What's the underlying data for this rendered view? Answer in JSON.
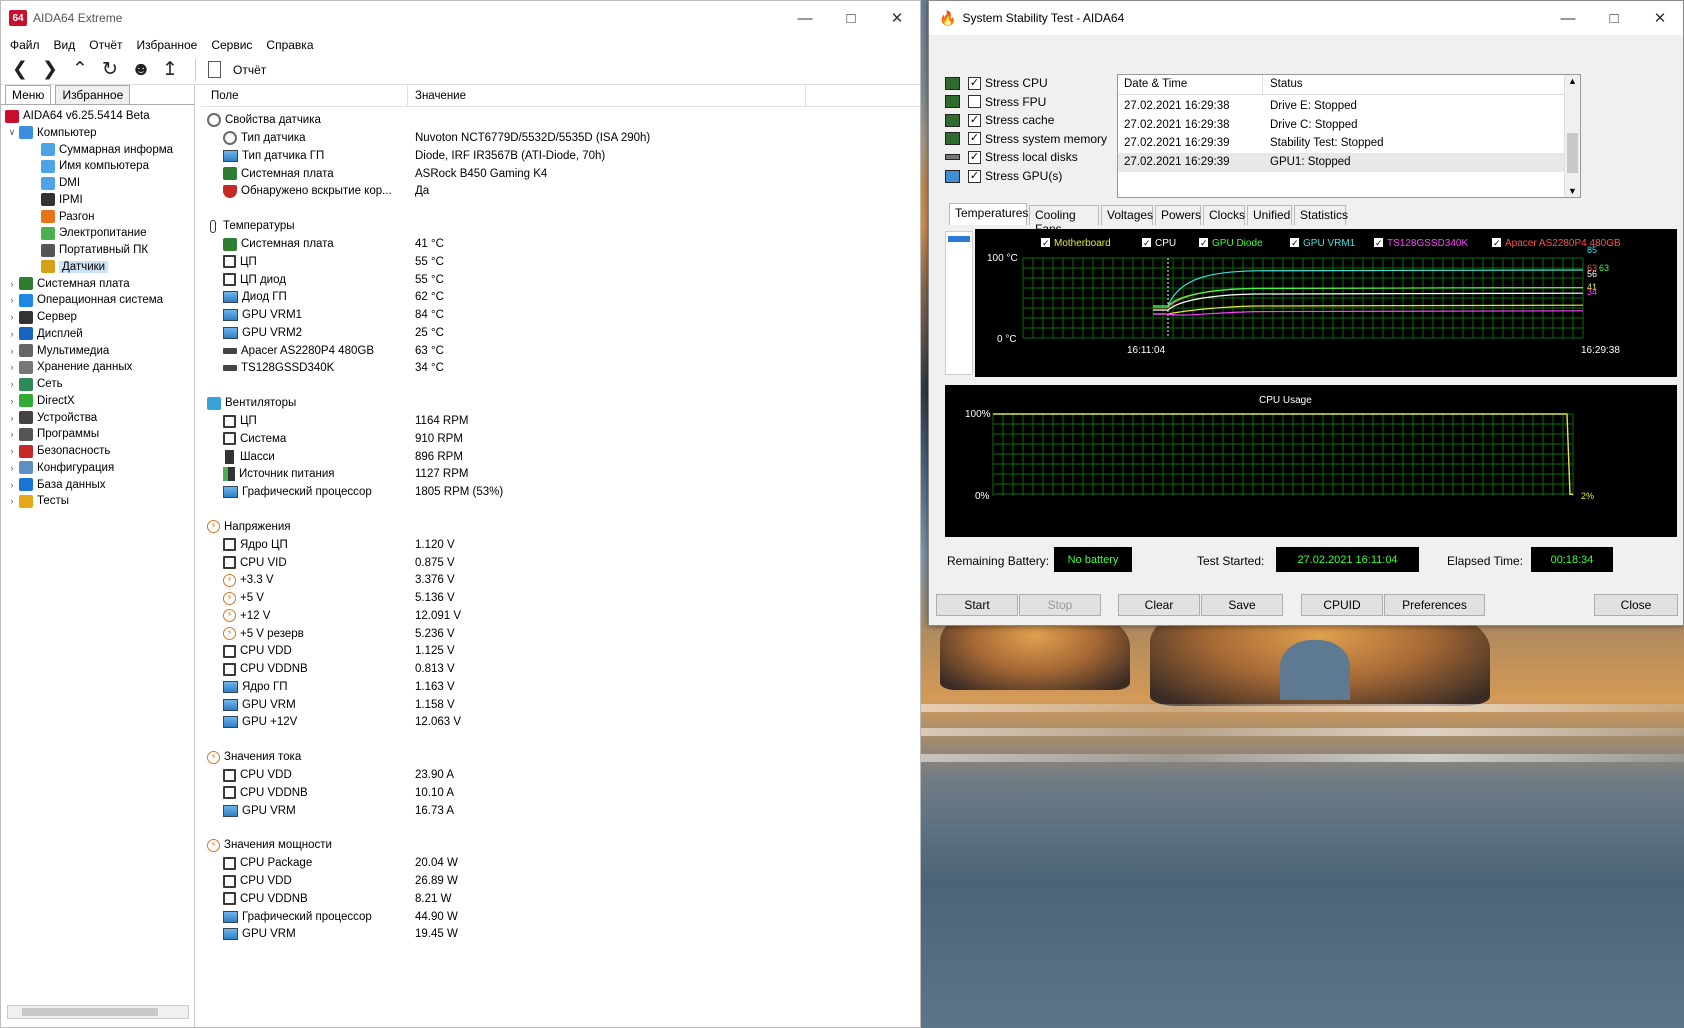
{
  "aida": {
    "title": "AIDA64 Extreme",
    "menu": [
      "Файл",
      "Вид",
      "Отчёт",
      "Избранное",
      "Сервис",
      "Справка"
    ],
    "report_label": "Отчёт",
    "tabs": [
      "Меню",
      "Избранное"
    ],
    "tree": [
      {
        "label": "AIDA64 v6.25.5414 Beta",
        "level": 0,
        "icon": "aida-logo-icon"
      },
      {
        "label": "Компьютер",
        "level": 1,
        "expanded": true,
        "icon": "computer-icon"
      },
      {
        "label": "Суммарная информа",
        "level": 2,
        "icon": "monitor-icon"
      },
      {
        "label": "Имя компьютера",
        "level": 2,
        "icon": "monitor-icon"
      },
      {
        "label": "DMI",
        "level": 2,
        "icon": "monitor-icon"
      },
      {
        "label": "IPMI",
        "level": 2,
        "icon": "server-icon"
      },
      {
        "label": "Разгон",
        "level": 2,
        "icon": "flame-icon"
      },
      {
        "label": "Электропитание",
        "level": 2,
        "icon": "battery-icon"
      },
      {
        "label": "Портативный ПК",
        "level": 2,
        "icon": "laptop-icon"
      },
      {
        "label": "Датчики",
        "level": 2,
        "icon": "gauge-icon",
        "selected": true
      },
      {
        "label": "Системная плата",
        "level": 1,
        "icon": "motherboard-icon"
      },
      {
        "label": "Операционная система",
        "level": 1,
        "icon": "windows-icon"
      },
      {
        "label": "Сервер",
        "level": 1,
        "icon": "server-icon"
      },
      {
        "label": "Дисплей",
        "level": 1,
        "icon": "display-icon"
      },
      {
        "label": "Мультимедиа",
        "level": 1,
        "icon": "music-icon"
      },
      {
        "label": "Хранение данных",
        "level": 1,
        "icon": "storage-icon"
      },
      {
        "label": "Сеть",
        "level": 1,
        "icon": "network-icon"
      },
      {
        "label": "DirectX",
        "level": 1,
        "icon": "directx-icon"
      },
      {
        "label": "Устройства",
        "level": 1,
        "icon": "devices-icon"
      },
      {
        "label": "Программы",
        "level": 1,
        "icon": "programs-icon"
      },
      {
        "label": "Безопасность",
        "level": 1,
        "icon": "shield-icon"
      },
      {
        "label": "Конфигурация",
        "level": 1,
        "icon": "config-icon"
      },
      {
        "label": "База данных",
        "level": 1,
        "icon": "database-icon"
      },
      {
        "label": "Тесты",
        "level": 1,
        "icon": "tests-icon"
      }
    ],
    "columns": {
      "field": "Поле",
      "value": "Значение"
    },
    "sections": [
      {
        "title": "Свойства датчика",
        "icon": "gauge-icon",
        "rows": [
          {
            "k": "Тип датчика",
            "v": "Nuvoton NCT6779D/5532D/5535D  (ISA 290h)",
            "icon": "gauge"
          },
          {
            "k": "Тип датчика ГП",
            "v": "Diode, IRF IR3567B  (ATI-Diode, 70h)",
            "icon": "mon"
          },
          {
            "k": "Системная плата",
            "v": "ASRock B450 Gaming K4",
            "icon": "board"
          },
          {
            "k": "Обнаружено вскрытие кор...",
            "v": "Да",
            "icon": "shield"
          }
        ]
      },
      {
        "title": "Температуры",
        "icon": "thermometer-icon",
        "rows": [
          {
            "k": "Системная плата",
            "v": "41 °C",
            "icon": "board"
          },
          {
            "k": "ЦП",
            "v": "55 °C",
            "icon": "bx"
          },
          {
            "k": "ЦП диод",
            "v": "55 °C",
            "icon": "bx"
          },
          {
            "k": "Диод ГП",
            "v": "62 °C",
            "icon": "mon"
          },
          {
            "k": "GPU VRM1",
            "v": "84 °C",
            "icon": "mon"
          },
          {
            "k": "GPU VRM2",
            "v": "25 °C",
            "icon": "mon"
          },
          {
            "k": "Apacer AS2280P4 480GB",
            "v": "63 °C",
            "icon": "disk"
          },
          {
            "k": "TS128GSSD340K",
            "v": "34 °C",
            "icon": "disk"
          }
        ]
      },
      {
        "title": "Вентиляторы",
        "icon": "fan-icon",
        "rows": [
          {
            "k": "ЦП",
            "v": "1164 RPM",
            "icon": "bx"
          },
          {
            "k": "Система",
            "v": "910 RPM",
            "icon": "bx"
          },
          {
            "k": "Шасси",
            "v": "896 RPM",
            "icon": "case"
          },
          {
            "k": "Источник питания",
            "v": "1127 RPM",
            "icon": "psu"
          },
          {
            "k": "Графический процессор",
            "v": "1805 RPM  (53%)",
            "icon": "mon"
          }
        ]
      },
      {
        "title": "Напряжения",
        "icon": "voltage-icon",
        "rows": [
          {
            "k": "Ядро ЦП",
            "v": "1.120 V",
            "icon": "bx"
          },
          {
            "k": "CPU VID",
            "v": "0.875 V",
            "icon": "bx"
          },
          {
            "k": "+3.3 V",
            "v": "3.376 V",
            "icon": "bolt"
          },
          {
            "k": "+5 V",
            "v": "5.136 V",
            "icon": "bolt"
          },
          {
            "k": "+12 V",
            "v": "12.091 V",
            "icon": "bolt"
          },
          {
            "k": "+5 V резерв",
            "v": "5.236 V",
            "icon": "bolt"
          },
          {
            "k": "CPU VDD",
            "v": "1.125 V",
            "icon": "bx"
          },
          {
            "k": "CPU VDDNB",
            "v": "0.813 V",
            "icon": "bx"
          },
          {
            "k": "Ядро ГП",
            "v": "1.163 V",
            "icon": "mon"
          },
          {
            "k": "GPU VRM",
            "v": "1.158 V",
            "icon": "mon"
          },
          {
            "k": "GPU +12V",
            "v": "12.063 V",
            "icon": "mon"
          }
        ]
      },
      {
        "title": "Значения тока",
        "icon": "current-icon",
        "rows": [
          {
            "k": "CPU VDD",
            "v": "23.90 A",
            "icon": "bx"
          },
          {
            "k": "CPU VDDNB",
            "v": "10.10 A",
            "icon": "bx"
          },
          {
            "k": "GPU VRM",
            "v": "16.73 A",
            "icon": "mon"
          }
        ]
      },
      {
        "title": "Значения мощности",
        "icon": "power-icon",
        "rows": [
          {
            "k": "CPU Package",
            "v": "20.04 W",
            "icon": "bx"
          },
          {
            "k": "CPU VDD",
            "v": "26.89 W",
            "icon": "bx"
          },
          {
            "k": "CPU VDDNB",
            "v": "8.21 W",
            "icon": "bx"
          },
          {
            "k": "Графический процессор",
            "v": "44.90 W",
            "icon": "mon"
          },
          {
            "k": "GPU VRM",
            "v": "19.45 W",
            "icon": "mon"
          }
        ]
      }
    ]
  },
  "sst": {
    "title": "System Stability Test - AIDA64",
    "options": [
      {
        "label": "Stress CPU",
        "checked": true
      },
      {
        "label": "Stress FPU",
        "checked": false
      },
      {
        "label": "Stress cache",
        "checked": true
      },
      {
        "label": "Stress system memory",
        "checked": true
      },
      {
        "label": "Stress local disks",
        "checked": true
      },
      {
        "label": "Stress GPU(s)",
        "checked": true
      }
    ],
    "log_headers": {
      "date": "Date & Time",
      "status": "Status"
    },
    "log": [
      {
        "date": "27.02.2021 16:29:38",
        "status": "Drive E: Stopped"
      },
      {
        "date": "27.02.2021 16:29:38",
        "status": "Drive C: Stopped"
      },
      {
        "date": "27.02.2021 16:29:39",
        "status": "Stability Test: Stopped"
      },
      {
        "date": "27.02.2021 16:29:39",
        "status": "GPU1: Stopped"
      }
    ],
    "tabs": [
      "Temperatures",
      "Cooling Fans",
      "Voltages",
      "Powers",
      "Clocks",
      "Unified",
      "Statistics"
    ],
    "temp_legend": [
      {
        "label": "Motherboard",
        "color": "#e6e640"
      },
      {
        "label": "CPU",
        "color": "#ffffff"
      },
      {
        "label": "GPU Diode",
        "color": "#3cff3c"
      },
      {
        "label": "GPU VRM1",
        "color": "#40e0e0"
      },
      {
        "label": "TS128GSSD340K",
        "color": "#ff40ff"
      },
      {
        "label": "Apacer AS2280P4 480GB",
        "color": "#ff5050"
      }
    ],
    "temp_axis": {
      "top": "100 °C",
      "bottom": "0 °C",
      "start": "16:11:04",
      "end": "16:29:38"
    },
    "temp_end_values": [
      {
        "text": "85",
        "color": "#40e0e0"
      },
      {
        "text": "63",
        "color": "#ff5050"
      },
      {
        "text": "63",
        "color": "#3cff3c"
      },
      {
        "text": "56",
        "color": "#ffffff"
      },
      {
        "text": "41",
        "color": "#e6e640"
      },
      {
        "text": "34",
        "color": "#ff40ff"
      }
    ],
    "cpu_usage": {
      "title": "CPU Usage",
      "top": "100%",
      "bottom": "0%",
      "end": "2%"
    },
    "status": {
      "battery_label": "Remaining Battery:",
      "battery": "No battery",
      "started_label": "Test Started:",
      "started": "27.02.2021 16:11:04",
      "elapsed_label": "Elapsed Time:",
      "elapsed": "00:18:34"
    },
    "buttons": {
      "start": "Start",
      "stop": "Stop",
      "clear": "Clear",
      "save": "Save",
      "cpuid": "CPUID",
      "prefs": "Preferences",
      "close": "Close"
    },
    "colors": {
      "grid": "#0a6e0a",
      "line_usage": "#e6e640"
    }
  }
}
